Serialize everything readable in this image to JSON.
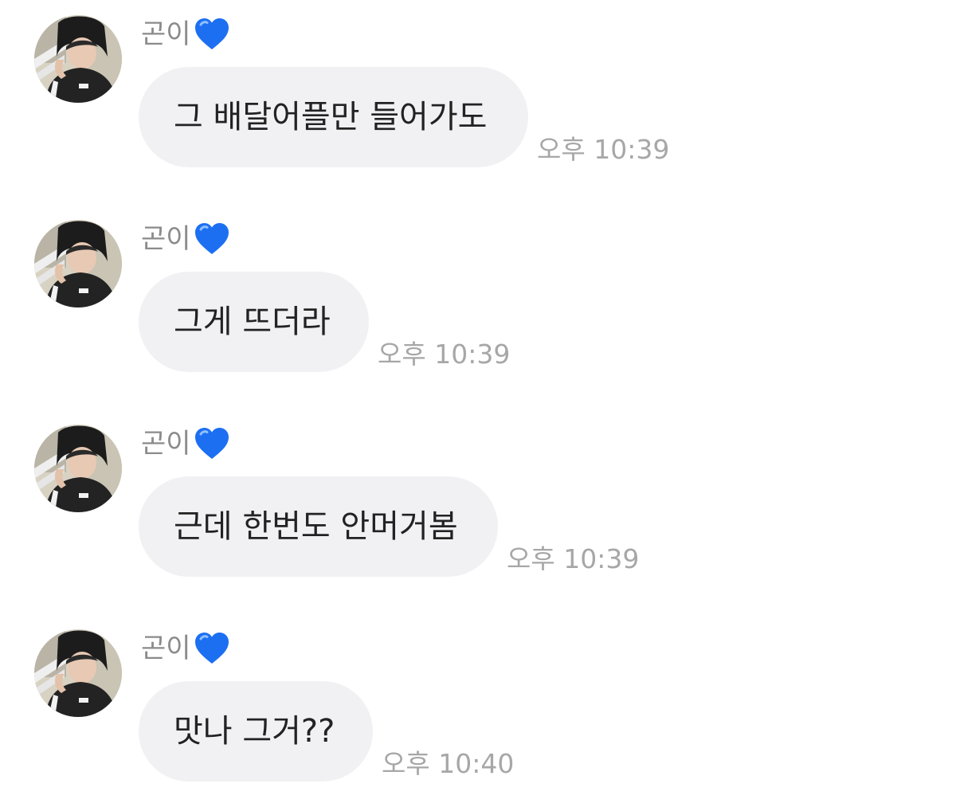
{
  "chat": {
    "accent_colors": {
      "bubble": "#f1f1f4",
      "heart": "#1d6ff2",
      "time": "#a7a7a7",
      "sender": "#8b8b8b"
    },
    "messages": [
      {
        "sender": "곤이",
        "sender_icon": "blue-heart-icon",
        "text": "그 배달어플만 들어가도",
        "time": "오후 10:39"
      },
      {
        "sender": "곤이",
        "sender_icon": "blue-heart-icon",
        "text": "그게 뜨더라",
        "time": "오후 10:39"
      },
      {
        "sender": "곤이",
        "sender_icon": "blue-heart-icon",
        "text": "근데 한번도 안머거봄",
        "time": "오후 10:39"
      },
      {
        "sender": "곤이",
        "sender_icon": "blue-heart-icon",
        "text": "맛나 그거??",
        "time": "오후 10:40"
      }
    ]
  }
}
